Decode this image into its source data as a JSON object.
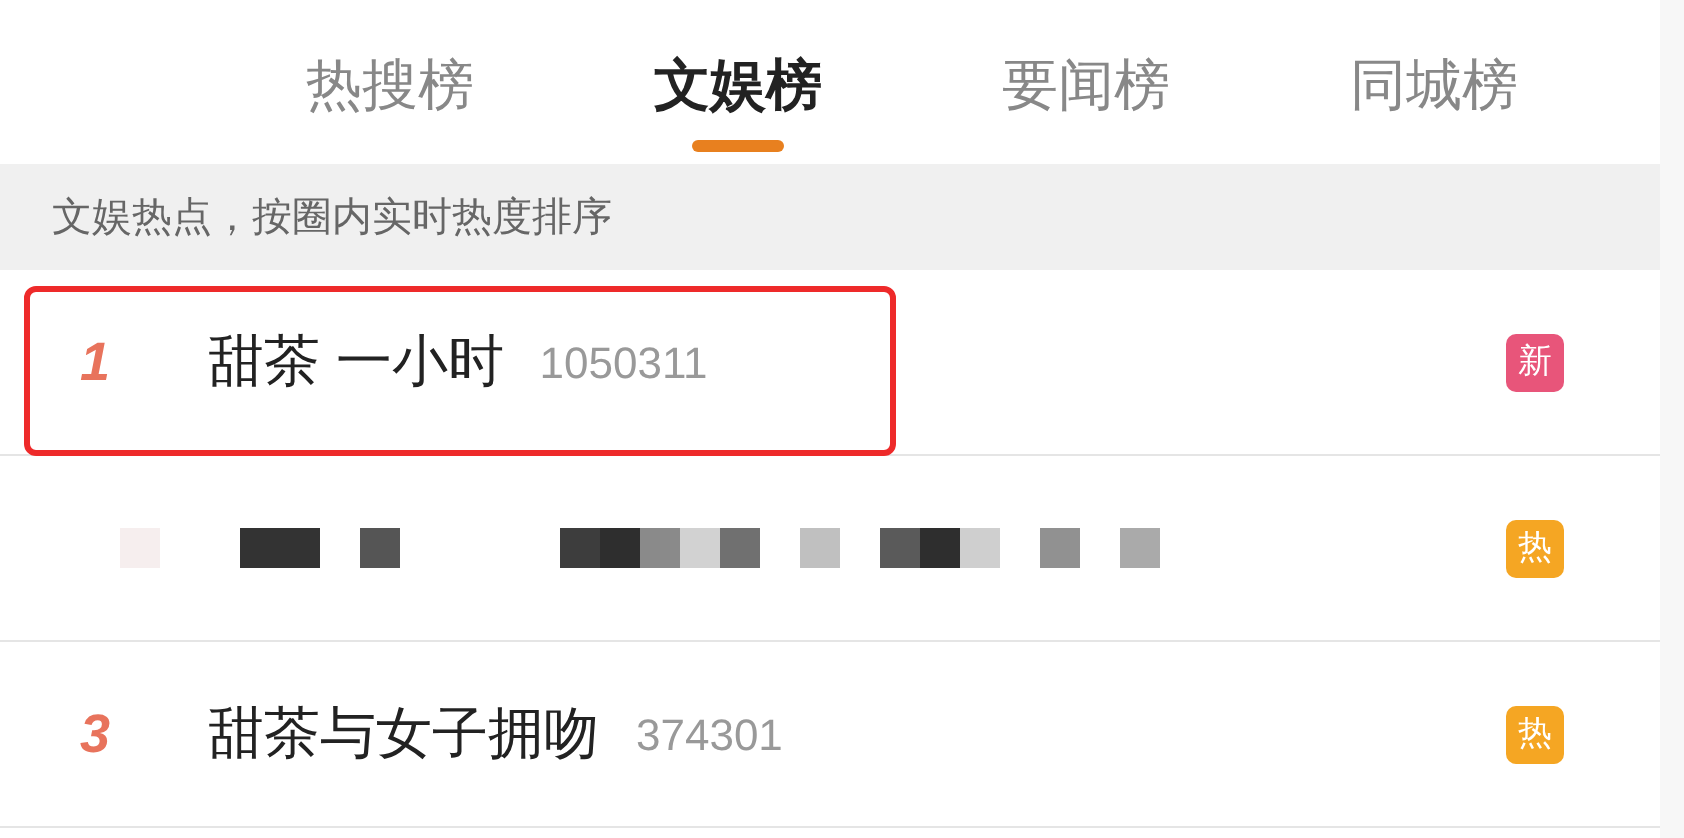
{
  "tabs": [
    {
      "label": "热搜榜",
      "selected": false
    },
    {
      "label": "文娱榜",
      "selected": true
    },
    {
      "label": "要闻榜",
      "selected": false
    },
    {
      "label": "同城榜",
      "selected": false
    }
  ],
  "subtitle": "文娱热点，按圈内实时热度排序",
  "rows": [
    {
      "kind": "item",
      "rank": "1",
      "title": "甜茶 一小时",
      "count": "1050311",
      "highlighted": true,
      "badge": {
        "text": "新",
        "color": "#e8557a"
      }
    },
    {
      "kind": "redacted",
      "highlighted": false,
      "badge": {
        "text": "热",
        "color": "#f5a623"
      }
    },
    {
      "kind": "item",
      "rank": "3",
      "title": "甜茶与女子拥吻",
      "count": "374301",
      "highlighted": false,
      "badge": {
        "text": "热",
        "color": "#f5a623"
      }
    }
  ]
}
